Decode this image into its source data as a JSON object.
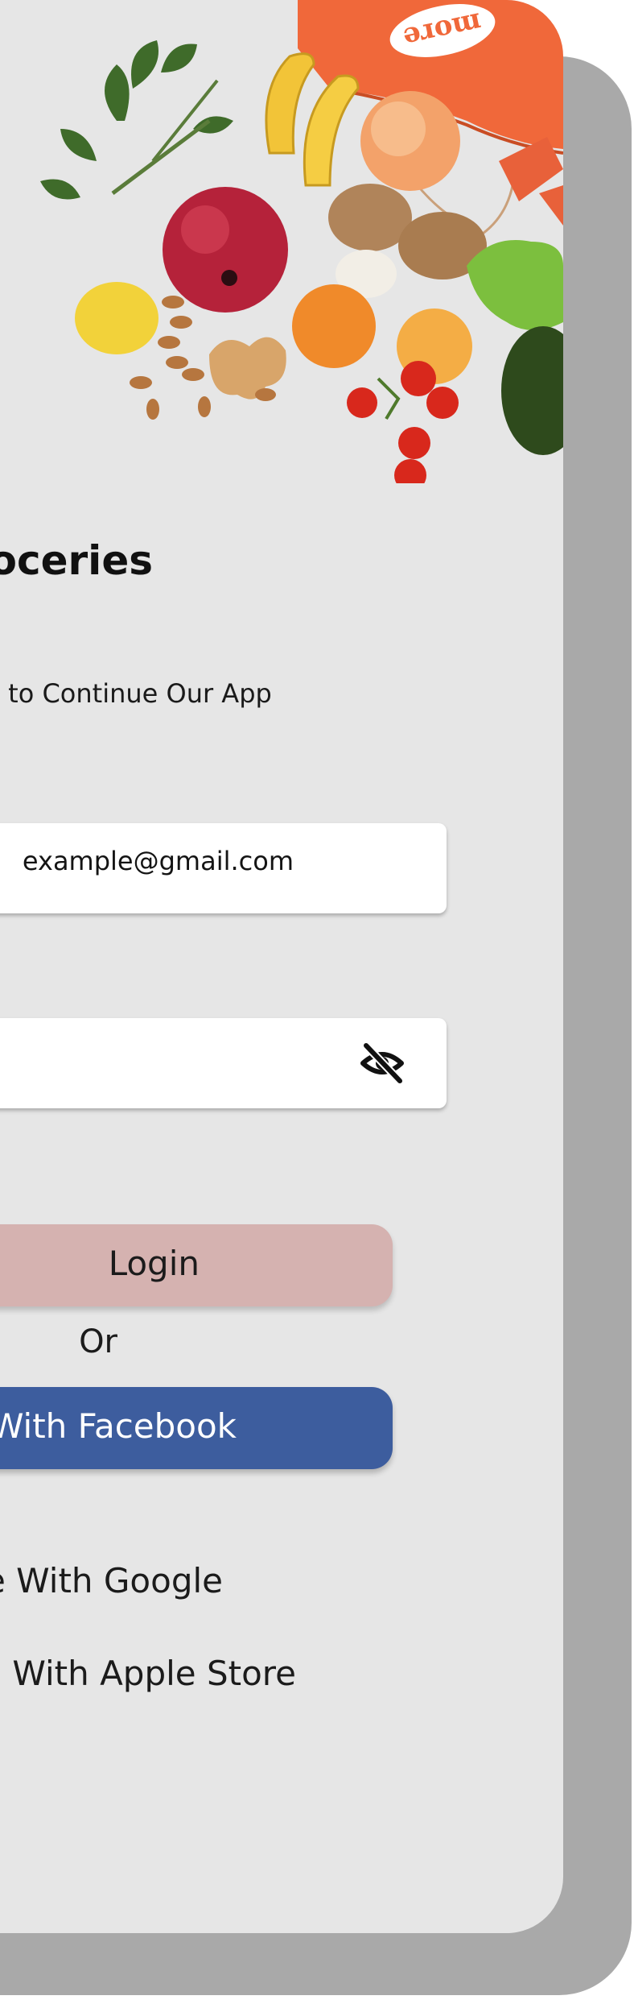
{
  "header": {
    "title": "Groceries",
    "subtitle": "Login or Sign up to Continue Our App",
    "bag_brand": "more"
  },
  "form": {
    "email_value": "example@gmail.com",
    "password_value": "**********",
    "password_toggle_icon": "eye-off-icon"
  },
  "actions": {
    "login_label": "Login",
    "or_label": "Or",
    "facebook_label": "Continue With Facebook",
    "google_label": "Continue With Google",
    "apple_label": "Continue With Apple Store"
  },
  "colors": {
    "card_background": "#e6e6e6",
    "card_shadow": "#a9a9a9",
    "login_button": "#d5b2b0",
    "facebook_button": "#3d5d9e",
    "field_background": "#ffffff"
  }
}
